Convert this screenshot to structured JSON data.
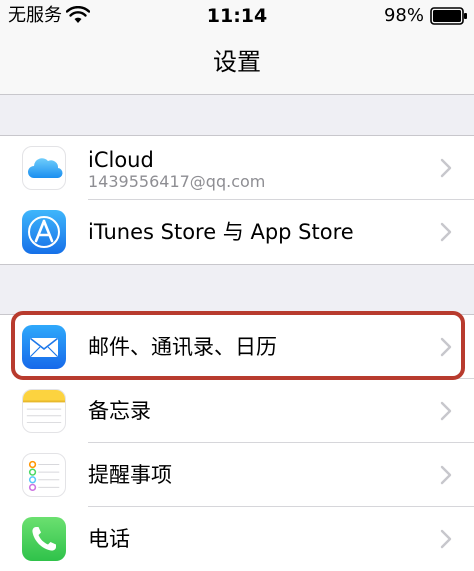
{
  "status_bar": {
    "carrier": "无服务",
    "time": "11:14",
    "battery_percent": "98%"
  },
  "nav": {
    "title": "设置"
  },
  "groups": [
    {
      "items": [
        {
          "label": "iCloud",
          "sublabel": "1439556417@qq.com",
          "icon": "icloud-icon"
        },
        {
          "label": "iTunes Store 与 App Store",
          "icon": "app-store-icon"
        }
      ]
    },
    {
      "items": [
        {
          "label": "邮件、通讯录、日历",
          "icon": "mail-icon",
          "highlighted": true
        },
        {
          "label": "备忘录",
          "icon": "notes-icon"
        },
        {
          "label": "提醒事项",
          "icon": "reminders-icon"
        },
        {
          "label": "电话",
          "icon": "phone-icon"
        }
      ]
    }
  ],
  "colors": {
    "background": "#efeff4",
    "highlight_border": "#b83b2e",
    "chevron": "#c7c7cc",
    "app_store_blue": "#1a8cf0",
    "phone_green": "#4cd964"
  }
}
